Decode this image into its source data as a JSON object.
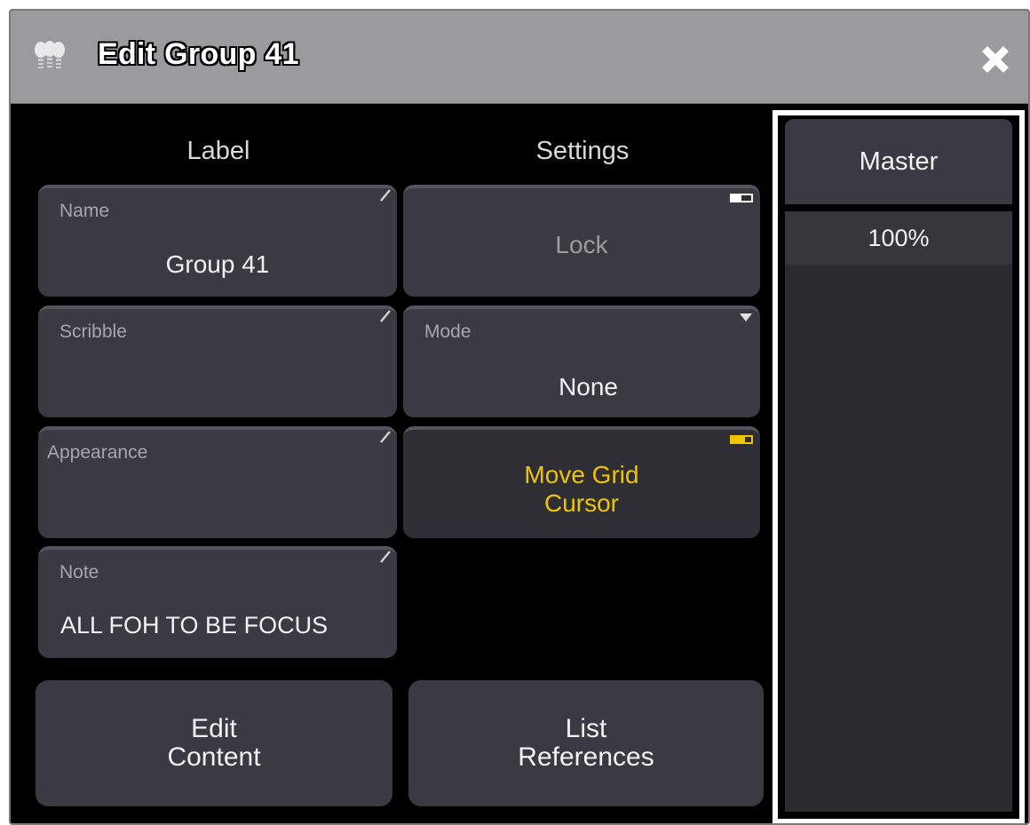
{
  "window": {
    "title": "Edit Group 41"
  },
  "columns": {
    "label_heading": "Label",
    "settings_heading": "Settings"
  },
  "label_fields": {
    "name": {
      "label": "Name",
      "value": "Group 41"
    },
    "scribble": {
      "label": "Scribble",
      "value": ""
    },
    "appearance": {
      "label": "Appearance",
      "value": ""
    },
    "note": {
      "label": "Note",
      "value": "ALL FOH TO BE FOCUS"
    }
  },
  "settings_fields": {
    "lock": {
      "label": "Lock",
      "state": "off"
    },
    "mode": {
      "label": "Mode",
      "value": "None"
    },
    "move_grid_cursor": {
      "line1": "Move Grid",
      "line2": "Cursor",
      "state": "on"
    }
  },
  "buttons": {
    "edit_content": {
      "line1": "Edit",
      "line2": "Content"
    },
    "list_references": {
      "line1": "List",
      "line2": "References"
    }
  },
  "master": {
    "heading": "Master",
    "value": "100%"
  },
  "colors": {
    "accent": "#f0c400",
    "button_bg": "#3a3a42",
    "titlebar": "#9b9b9e"
  },
  "icons": {
    "title": "lights-group-icon",
    "close": "close-icon",
    "edit_corner": "edit-corner-icon",
    "dropdown": "dropdown-triangle-icon",
    "toggle": "toggle-indicator-icon"
  }
}
